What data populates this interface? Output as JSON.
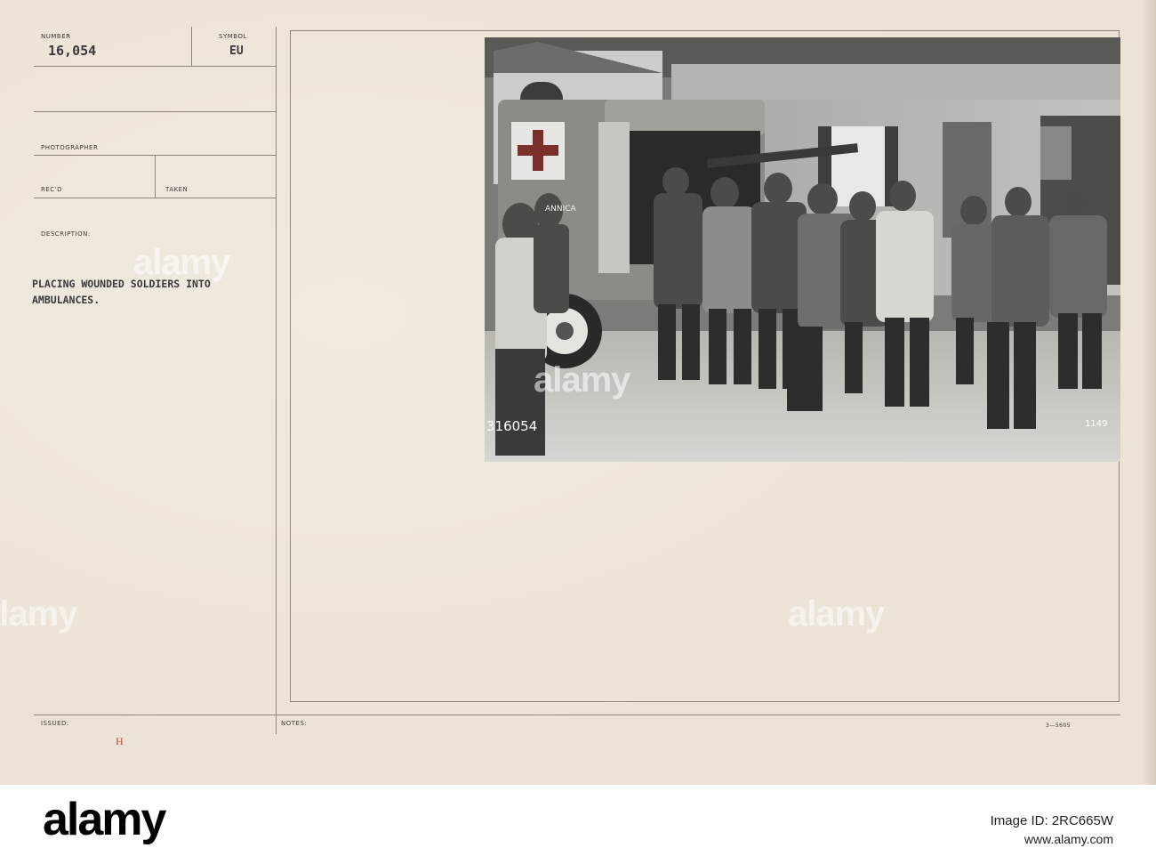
{
  "card": {
    "number_label": "NUMBER",
    "number_value": "16,054",
    "symbol_label": "SYMBOL",
    "symbol_value": "EU",
    "photographer_label": "PHOTOGRAPHER",
    "recd_label": "REC'D",
    "taken_label": "TAKEN",
    "description_label": "DESCRIPTION:",
    "description_line1": "PLACING WOUNDED SOLDIERS INTO",
    "description_line2": "AMBULANCES.",
    "issued_label": "ISSUED:",
    "issued_mark": "H",
    "notes_label": "NOTES:",
    "form_code": "3—5605"
  },
  "photo": {
    "negative_number": "316054",
    "corner_number": "1149",
    "vehicle_text": "ANNICA"
  },
  "watermark": {
    "text": "alamy"
  },
  "footer": {
    "logo": "alamy",
    "image_id": "Image ID: 2RC665W",
    "url": "www.alamy.com"
  },
  "colors": {
    "card_background": "#ebe3d5",
    "rule": "#8f8778",
    "stamp_red": "#c44a43",
    "typewriter_ink": "#3b3a3a"
  }
}
